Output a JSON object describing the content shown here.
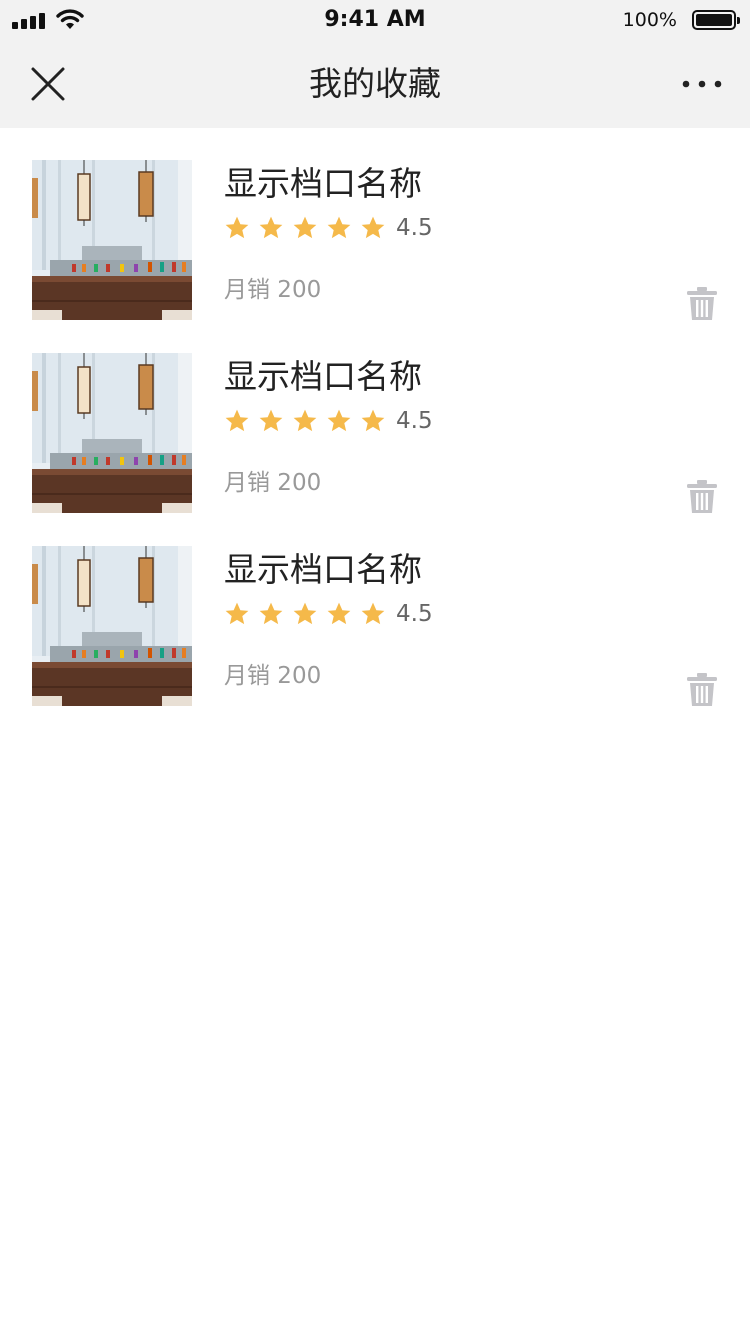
{
  "status_bar": {
    "time": "9:41 AM",
    "battery": "100%"
  },
  "nav": {
    "title": "我的收藏"
  },
  "favorites": [
    {
      "name": "显示档口名称",
      "rating": "4.5",
      "stars": 5,
      "sales": "月销 200"
    },
    {
      "name": "显示档口名称",
      "rating": "4.5",
      "stars": 5,
      "sales": "月销 200"
    },
    {
      "name": "显示档口名称",
      "rating": "4.5",
      "stars": 5,
      "sales": "月销 200"
    }
  ],
  "colors": {
    "star": "#f5b94a",
    "trash": "#c4c4c8",
    "bar_background": "#f2f2f2"
  }
}
